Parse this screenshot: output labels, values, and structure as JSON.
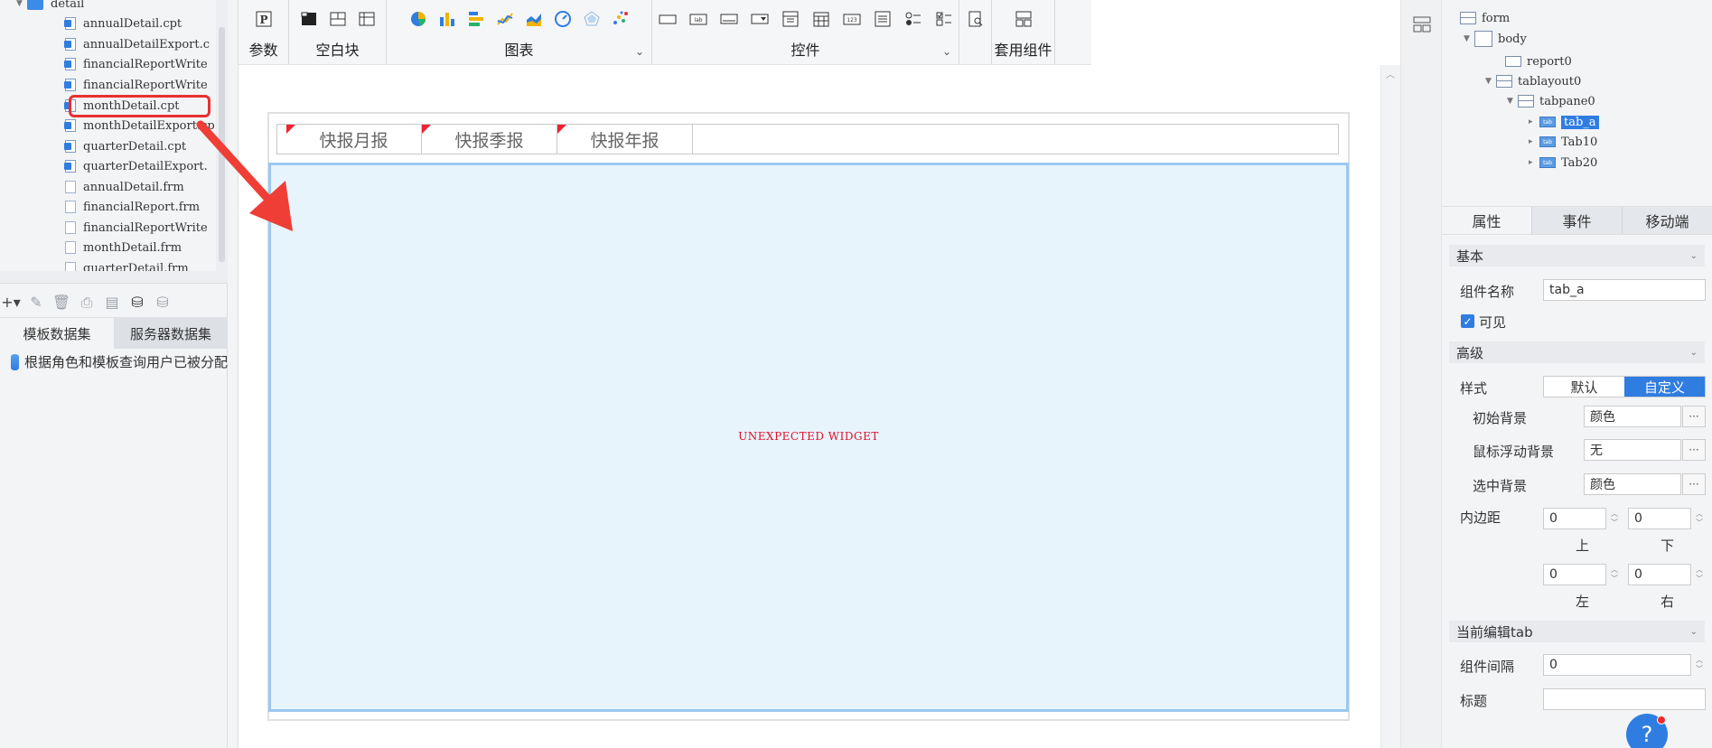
{
  "file_tree": {
    "folder": "detail",
    "files": [
      {
        "name": "annualDetail.cpt",
        "type": "cpt"
      },
      {
        "name": "annualDetailExport.c",
        "type": "cpt"
      },
      {
        "name": "financialReportWrite",
        "type": "cpt"
      },
      {
        "name": "financialReportWrite",
        "type": "cpt"
      },
      {
        "name": "monthDetail.cpt",
        "type": "cpt"
      },
      {
        "name": "monthDetailExport.cp",
        "type": "cpt"
      },
      {
        "name": "quarterDetail.cpt",
        "type": "cpt"
      },
      {
        "name": "quarterDetailExport.",
        "type": "cpt"
      },
      {
        "name": "annualDetail.frm",
        "type": "frm"
      },
      {
        "name": "financialReport.frm",
        "type": "frm"
      },
      {
        "name": "financialReportWrite",
        "type": "frm"
      },
      {
        "name": "monthDetail.frm",
        "type": "frm"
      },
      {
        "name": "quarterDetail.frm",
        "type": "frm"
      }
    ],
    "highlighted_index": 4
  },
  "dataset_panel": {
    "tabs": [
      "模板数据集",
      "服务器数据集"
    ],
    "active_tab": 0,
    "items": [
      "根据角色和模板查询用户已被分配"
    ]
  },
  "toolbar": {
    "groups": [
      {
        "label": "参数",
        "icons": [
          "param-icon"
        ]
      },
      {
        "label": "空白块",
        "icons": [
          "block-icon",
          "split-layout-icon",
          "grid-layout-icon"
        ]
      },
      {
        "label": "图表",
        "icons": [
          "pie-chart-icon",
          "bar-chart-icon",
          "hbar-chart-icon",
          "line-chart-icon",
          "area-chart-icon",
          "gauge-chart-icon",
          "radar-chart-icon",
          "scatter-chart-icon"
        ],
        "dropdown": true
      },
      {
        "label": "控件",
        "icons": [
          "textbox-icon",
          "label-icon",
          "button-icon",
          "combobox-icon",
          "dropdown-tree-icon",
          "date-icon",
          "number-icon",
          "list-icon",
          "radio-group-icon",
          "checkbox-group-icon"
        ],
        "dropdown": true
      },
      {
        "label": "",
        "icons": [
          "search-doc-icon"
        ]
      },
      {
        "label": "套用组件",
        "icons": [
          "template-component-icon"
        ]
      }
    ]
  },
  "canvas": {
    "tabs": [
      "快报月报",
      "快报季报",
      "快报年报"
    ],
    "widget_message": "UNEXPECTED WIDGET"
  },
  "component_tree": {
    "nodes": [
      {
        "label": "form",
        "level": 0
      },
      {
        "label": "body",
        "level": 1
      },
      {
        "label": "report0",
        "level": 2
      },
      {
        "label": "tablayout0",
        "level": 2
      },
      {
        "label": "tabpane0",
        "level": 3
      },
      {
        "label": "tab_a",
        "level": 4,
        "selected": true
      },
      {
        "label": "Tab10",
        "level": 4
      },
      {
        "label": "Tab20",
        "level": 4
      }
    ]
  },
  "properties": {
    "tabs": [
      "属性",
      "事件",
      "移动端"
    ],
    "active_tab": 0,
    "basic_section": "基本",
    "component_name_label": "组件名称",
    "component_name_value": "tab_a",
    "visible_label": "可见",
    "advanced_section": "高级",
    "style_label": "样式",
    "style_options": [
      "默认",
      "自定义"
    ],
    "style_selected": 1,
    "initial_bg_label": "初始背景",
    "initial_bg_value": "颜色",
    "hover_bg_label": "鼠标浮动背景",
    "hover_bg_value": "无",
    "selected_bg_label": "选中背景",
    "selected_bg_value": "颜色",
    "padding_label": "内边距",
    "padding_top": "0",
    "padding_bottom": "0",
    "padding_left": "0",
    "padding_right": "0",
    "top_label": "上",
    "bottom_label": "下",
    "left_label": "左",
    "right_label": "右",
    "current_tab_section": "当前编辑tab",
    "gap_label": "组件间隔",
    "gap_value": "0",
    "title_label": "标题",
    "title_value": "",
    "more_label": "···"
  },
  "colors": {
    "accent": "#2f7de1",
    "highlight_box": "#e8312f",
    "arrow": "#ef3e36",
    "content_bg": "#e8f4fc",
    "content_border": "#9cc8f0",
    "warning_text": "#e0102a"
  }
}
